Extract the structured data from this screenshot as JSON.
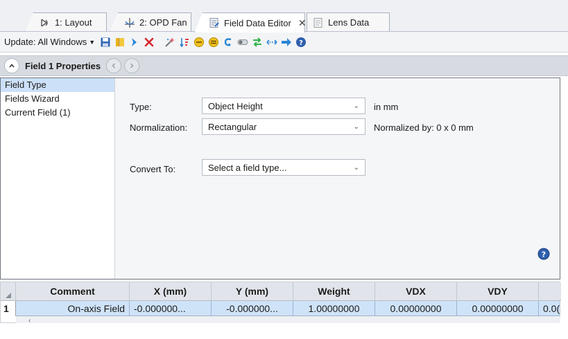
{
  "tabs": [
    {
      "label": "1: Layout",
      "icon": "layout-icon"
    },
    {
      "label": "2: OPD Fan",
      "icon": "opd-fan-icon"
    },
    {
      "label": "Field Data Editor",
      "icon": "editor-icon",
      "active": true
    },
    {
      "label": "Lens Data",
      "icon": "lens-data-icon"
    }
  ],
  "toolbar": {
    "update_label": "Update: All Windows",
    "icons": [
      "save-icon",
      "book-icon",
      "insert-arrow-icon",
      "delete-x-icon",
      "wizard-icon",
      "sort-icon",
      "circle-minus-icon",
      "circle-equal-icon",
      "undo-icon",
      "toggle-icon",
      "swap-icon",
      "expand-arrows-icon",
      "forward-arrow-icon",
      "help-icon"
    ]
  },
  "section": {
    "title": "Field  1 Properties"
  },
  "nav": {
    "items": [
      {
        "label": "Field Type",
        "selected": true
      },
      {
        "label": "Fields Wizard",
        "selected": false
      },
      {
        "label": "Current Field (1)",
        "selected": false
      }
    ]
  },
  "form": {
    "type_label": "Type:",
    "type_value": "Object Height",
    "type_unit": "in mm",
    "normalization_label": "Normalization:",
    "normalization_value": "Rectangular",
    "normalized_by": "Normalized by: 0 x 0 mm",
    "convert_label": "Convert To:",
    "convert_value": "Select a field type..."
  },
  "grid": {
    "columns": [
      "Comment",
      "X (mm)",
      "Y (mm)",
      "Weight",
      "VDX",
      "VDY",
      ""
    ],
    "rows": [
      {
        "num": "1",
        "cells": [
          "On-axis Field",
          "-0.000000...",
          "-0.000000...",
          "1.00000000",
          "0.00000000",
          "0.00000000",
          "0.0("
        ]
      }
    ]
  },
  "colors": {
    "accent": "#cce0f7",
    "selected_row": "#cfe3f8",
    "header_bg": "#d7dbe1"
  }
}
